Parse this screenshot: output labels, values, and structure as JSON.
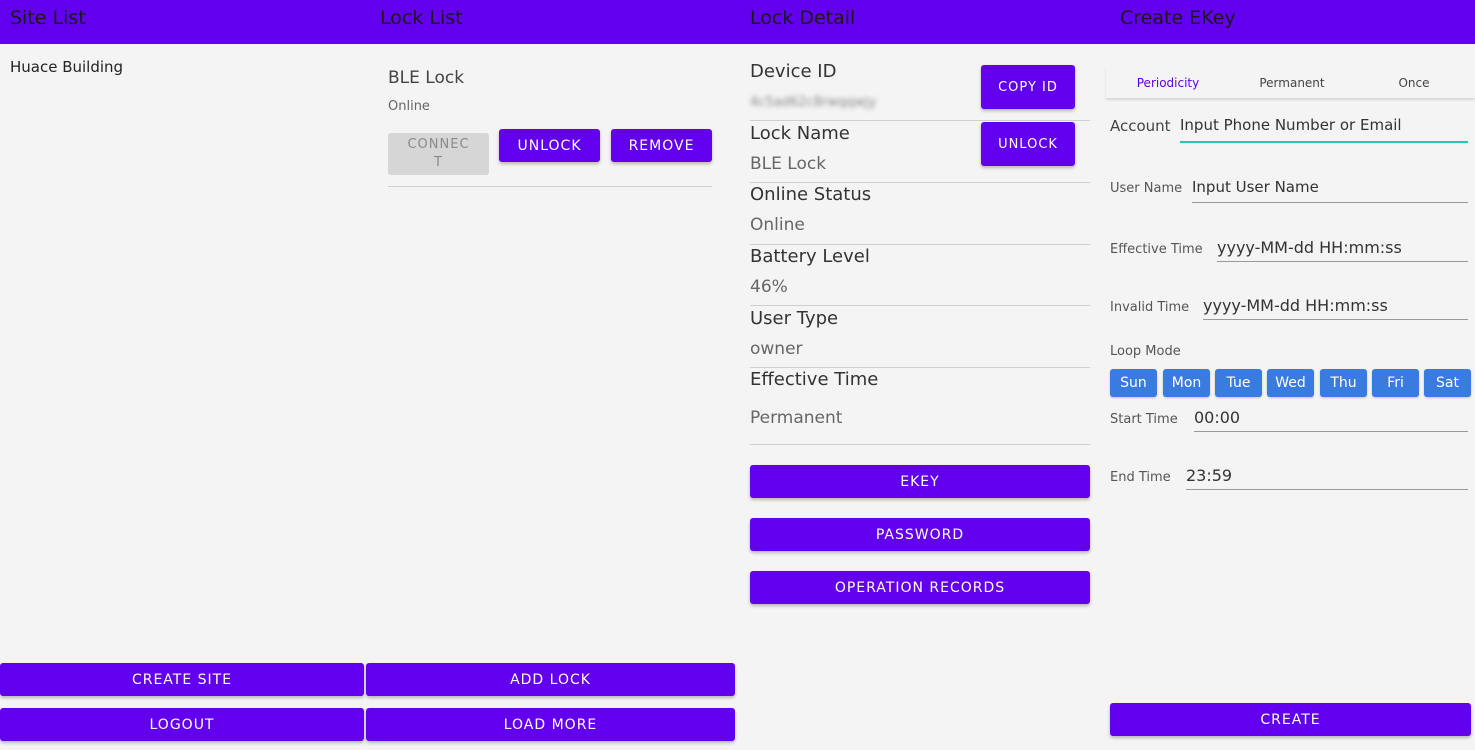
{
  "site_list": {
    "title": "Site List",
    "sites": [
      "Huace Building"
    ],
    "create_site_label": "CREATE SITE",
    "logout_label": "LOGOUT"
  },
  "lock_list": {
    "title": "Lock List",
    "locks": [
      {
        "name": "BLE Lock",
        "status": "Online",
        "connect_label": "CONNECT",
        "unlock_label": "UNLOCK",
        "remove_label": "REMOVE"
      }
    ],
    "add_lock_label": "ADD LOCK",
    "load_more_label": "LOAD MORE"
  },
  "lock_detail": {
    "title": "Lock Detail",
    "device_id_label": "Device ID",
    "device_id_value": "4c5ad62c8rwqqwjy",
    "copy_id_label": "COPY ID",
    "lock_name_label": "Lock Name",
    "lock_name_value": "BLE Lock",
    "unlock_label": "UNLOCK",
    "online_status_label": "Online Status",
    "online_status_value": "Online",
    "battery_label": "Battery Level",
    "battery_value": "46%",
    "user_type_label": "User Type",
    "user_type_value": "owner",
    "effective_time_label": "Effective Time",
    "effective_time_value": "Permanent",
    "ekey_label": "EKEY",
    "password_label": "PASSWORD",
    "records_label": "OPERATION RECORDS"
  },
  "create_ekey": {
    "title": "Create EKey",
    "tabs": [
      "Periodicity",
      "Permanent",
      "Once"
    ],
    "active_tab": "Periodicity",
    "account_label": "Account",
    "account_placeholder": "Input Phone Number or Email",
    "user_name_label": "User Name",
    "user_name_placeholder": "Input User Name",
    "effective_time_label": "Effective Time",
    "effective_time_placeholder": "yyyy-MM-dd HH:mm:ss",
    "invalid_time_label": "Invalid Time",
    "invalid_time_placeholder": "yyyy-MM-dd HH:mm:ss",
    "loop_mode_label": "Loop Mode",
    "days": [
      "Sun",
      "Mon",
      "Tue",
      "Wed",
      "Thu",
      "Fri",
      "Sat"
    ],
    "start_time_label": "Start Time",
    "start_time_value": "00:00",
    "end_time_label": "End Time",
    "end_time_value": "23:59",
    "create_label": "CREATE"
  },
  "colors": {
    "primary": "#6200ee",
    "accent": "#03dac5",
    "day_button": "#3a7be0",
    "background": "#f4f4f4"
  }
}
